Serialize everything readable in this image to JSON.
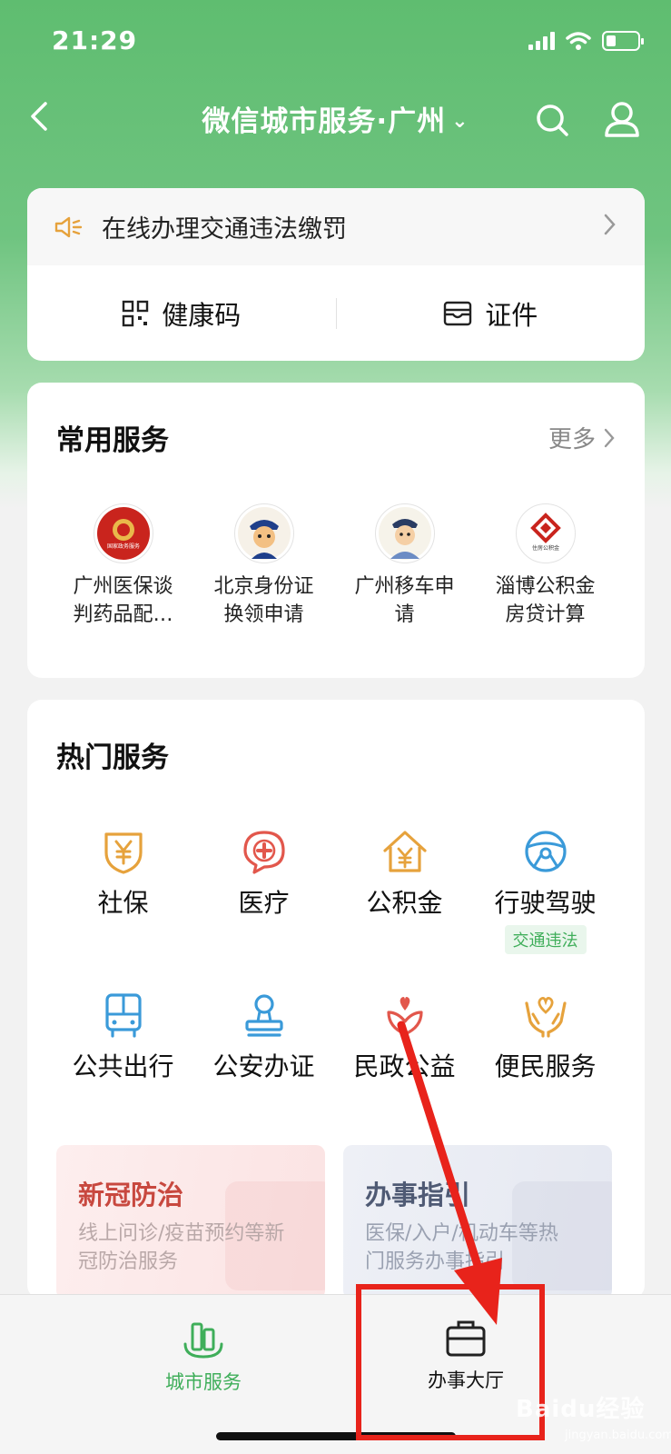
{
  "status_bar": {
    "time": "21:29"
  },
  "nav": {
    "title": "微信城市服务·广州",
    "chevron": "⌄"
  },
  "notice": {
    "text": "在线办理交通违法缴罚"
  },
  "quick": {
    "health_code": "健康码",
    "certificate": "证件"
  },
  "common_services": {
    "title": "常用服务",
    "more": "更多",
    "items": [
      {
        "label": "广州医保谈判药品配…",
        "badge": "国家政务服务"
      },
      {
        "label": "北京身份证换领申请"
      },
      {
        "label": "广州移车申请"
      },
      {
        "label": "淄博公积金房贷计算",
        "badge": "住房公积金"
      }
    ]
  },
  "hot_services": {
    "title": "热门服务",
    "items": [
      {
        "label": "社保",
        "icon": "shield-yuan-icon",
        "color": "#e6a23c"
      },
      {
        "label": "医疗",
        "icon": "medical-cross-icon",
        "color": "#e2574c"
      },
      {
        "label": "公积金",
        "icon": "house-yuan-icon",
        "color": "#e6a23c"
      },
      {
        "label": "行驶驾驶",
        "icon": "steering-wheel-icon",
        "color": "#3a9ad9",
        "tag": "交通违法"
      },
      {
        "label": "公共出行",
        "icon": "bus-icon",
        "color": "#3a9ad9"
      },
      {
        "label": "公安办证",
        "icon": "stamp-icon",
        "color": "#3a9ad9"
      },
      {
        "label": "民政公益",
        "icon": "heart-flower-icon",
        "color": "#e2574c"
      },
      {
        "label": "便民服务",
        "icon": "hands-heart-icon",
        "color": "#e6a23c"
      }
    ]
  },
  "promos": [
    {
      "title": "新冠防治",
      "desc": "线上问诊/疫苗预约等新冠防治服务"
    },
    {
      "title": "办事指引",
      "desc": "医保/入户/机动车等热门服务办事指引"
    }
  ],
  "tabbar": {
    "city": "城市服务",
    "hall": "办事大厅"
  },
  "watermark": {
    "brand": "Baidu经验",
    "url": "jingyan.baidu.com"
  },
  "colors": {
    "accent_green": "#3fae5a",
    "header_green": "#5fbd70",
    "annotation_red": "#e8231b"
  }
}
